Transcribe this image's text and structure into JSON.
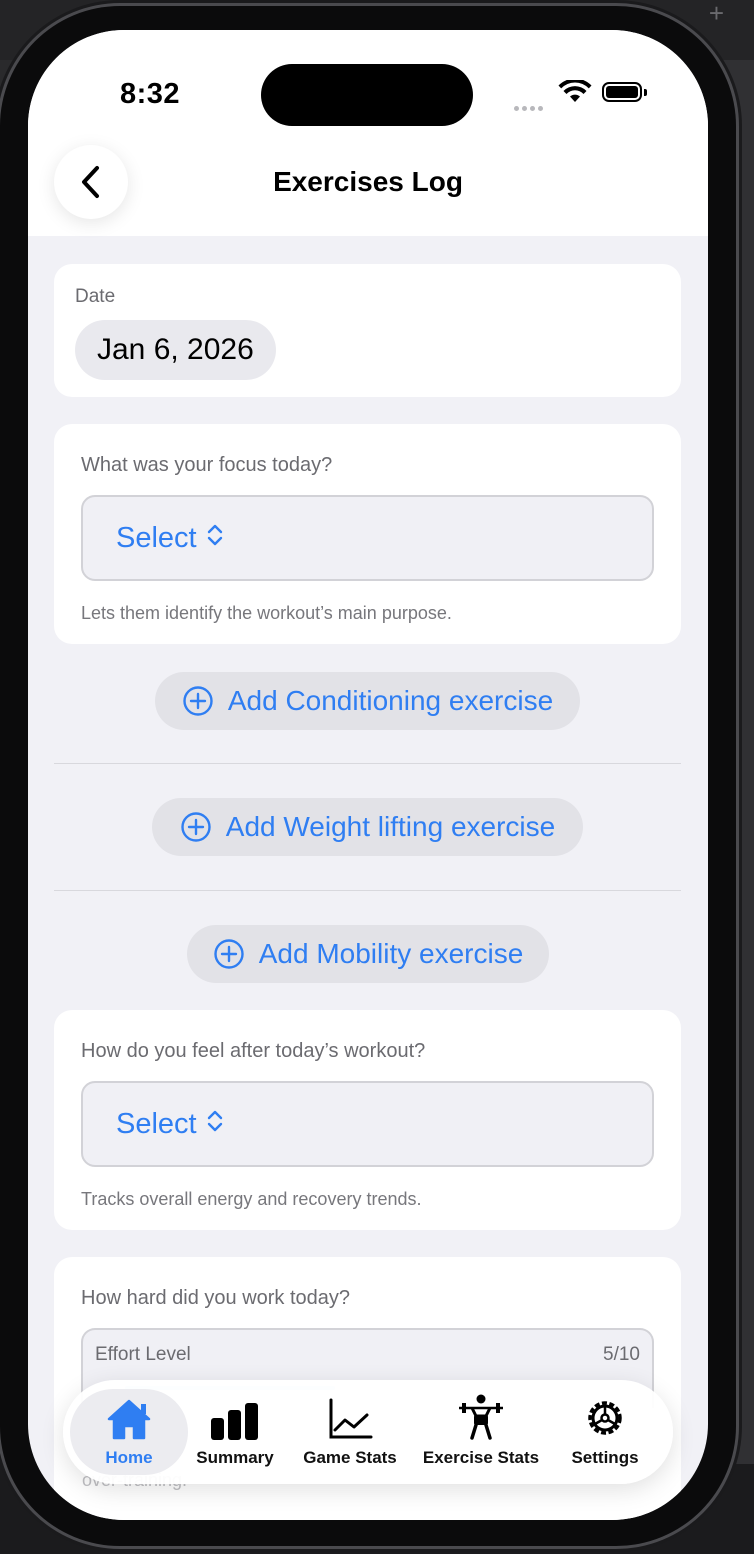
{
  "status": {
    "time": "8:32"
  },
  "nav": {
    "title": "Exercises Log"
  },
  "date": {
    "label": "Date",
    "value": "Jan 6, 2026"
  },
  "focus": {
    "question": "What was your focus today?",
    "select_label": "Select",
    "hint": "Lets them identify the workout’s main purpose."
  },
  "add_buttons": {
    "conditioning": "Add Conditioning exercise",
    "weight": "Add Weight lifting exercise",
    "mobility": "Add Mobility exercise"
  },
  "feel": {
    "question": "How do you feel after today’s workout?",
    "select_label": "Select",
    "hint": "Tracks overall energy and recovery trends."
  },
  "effort": {
    "question": "How hard did you work today?",
    "label": "Effort Level",
    "value_text": "5/10",
    "value": 5,
    "max": 10,
    "trailing_hint": "over-training."
  },
  "tabs": [
    {
      "label": "Home",
      "icon": "house-icon",
      "active": true
    },
    {
      "label": "Summary",
      "icon": "bar-chart-icon",
      "active": false
    },
    {
      "label": "Game Stats",
      "icon": "line-chart-icon",
      "active": false
    },
    {
      "label": "Exercise Stats",
      "icon": "weightlifter-icon",
      "active": false
    },
    {
      "label": "Settings",
      "icon": "gear-icon",
      "active": false
    }
  ],
  "colors": {
    "accent": "#2f7ef2",
    "background": "#f1f1f6",
    "card": "#ffffff"
  }
}
